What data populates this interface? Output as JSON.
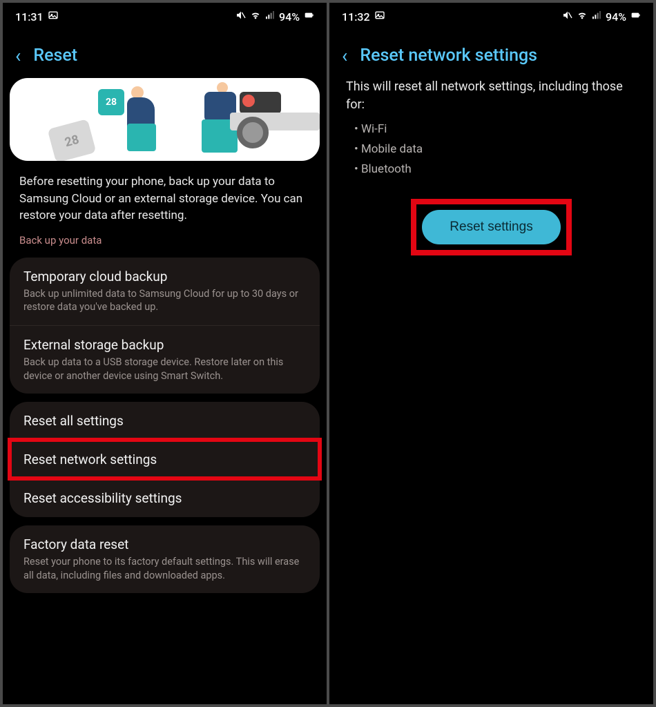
{
  "left": {
    "status": {
      "time": "11:31",
      "battery": "94%"
    },
    "header": {
      "title": "Reset"
    },
    "illustration": {
      "cal_big": "28",
      "cal_small": "28"
    },
    "intro": "Before resetting your phone, back up your data to Samsung Cloud or an external storage device. You can restore your data after resetting.",
    "backup_label": "Back up your data",
    "backup_items": [
      {
        "title": "Temporary cloud backup",
        "sub": "Back up unlimited data to Samsung Cloud for up to 30 days or restore data you've backed up."
      },
      {
        "title": "External storage backup",
        "sub": "Back up data to a USB storage device. Restore later on this device or another device using Smart Switch."
      }
    ],
    "reset_items": [
      {
        "title": "Reset all settings"
      },
      {
        "title": "Reset network settings"
      },
      {
        "title": "Reset accessibility settings"
      }
    ],
    "factory": {
      "title": "Factory data reset",
      "sub": "Reset your phone to its factory default settings. This will erase all data, including files and downloaded apps."
    }
  },
  "right": {
    "status": {
      "time": "11:32",
      "battery": "94%"
    },
    "header": {
      "title": "Reset network settings"
    },
    "desc": "This will reset all network settings, including those for:",
    "bullets": [
      "Wi-Fi",
      "Mobile data",
      "Bluetooth"
    ],
    "button": "Reset settings"
  }
}
